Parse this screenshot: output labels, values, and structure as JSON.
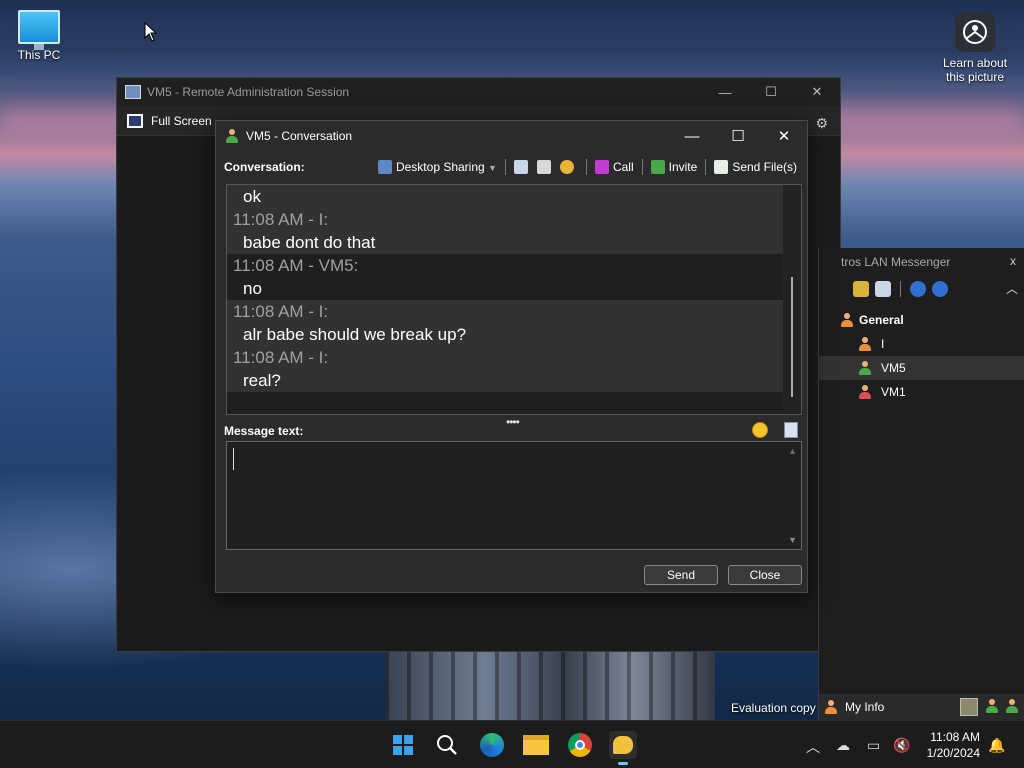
{
  "desktop": {
    "icons": [
      {
        "label": "This PC",
        "icon": "computer-icon"
      },
      {
        "label": "Learn about this picture",
        "icon": "learn-picture-icon"
      }
    ],
    "watermark": "Evaluation copy"
  },
  "remote_window": {
    "title": "VM5 - Remote Administration Session",
    "toolbar": {
      "fullscreen_label": "Full Screen"
    },
    "controls": {
      "minimize": "—",
      "maximize": "☐",
      "close": "✕"
    }
  },
  "messenger": {
    "title": "tros LAN Messenger",
    "close": "x",
    "group": "General",
    "users": [
      {
        "name": "I",
        "color": "#e8903a",
        "selected": false
      },
      {
        "name": "VM5",
        "color": "#4ba84a",
        "selected": true
      },
      {
        "name": "VM1",
        "color": "#d84f5b",
        "selected": false
      }
    ],
    "my_info": "My Info"
  },
  "conversation": {
    "title": "VM5 - Conversation",
    "label": "Conversation:",
    "toolbar": {
      "desktop_sharing": "Desktop Sharing",
      "call": "Call",
      "invite": "Invite",
      "send_files": "Send File(s)"
    },
    "messages": [
      {
        "time": "",
        "text": "ok",
        "shaded": true
      },
      {
        "time": "11:08 AM - I:",
        "text": "babe dont do that",
        "shaded": true
      },
      {
        "time": "11:08 AM - VM5:",
        "text": "no",
        "shaded": false
      },
      {
        "time": "11:08 AM - I:",
        "text": "alr babe should we break up?",
        "shaded": true
      },
      {
        "time": "11:08 AM - I:",
        "text": "real?",
        "shaded": true
      }
    ],
    "message_label": "Message text:",
    "input_value": "",
    "send_label": "Send",
    "close_label": "Close",
    "controls": {
      "minimize": "—",
      "maximize": "☐",
      "close": "✕"
    }
  },
  "taskbar": {
    "time": "11:08 AM",
    "date": "1/20/2024",
    "apps": [
      "start-icon",
      "search-icon",
      "edge-beta-icon",
      "file-explorer-icon",
      "chrome-icon",
      "lan-messenger-icon"
    ]
  }
}
